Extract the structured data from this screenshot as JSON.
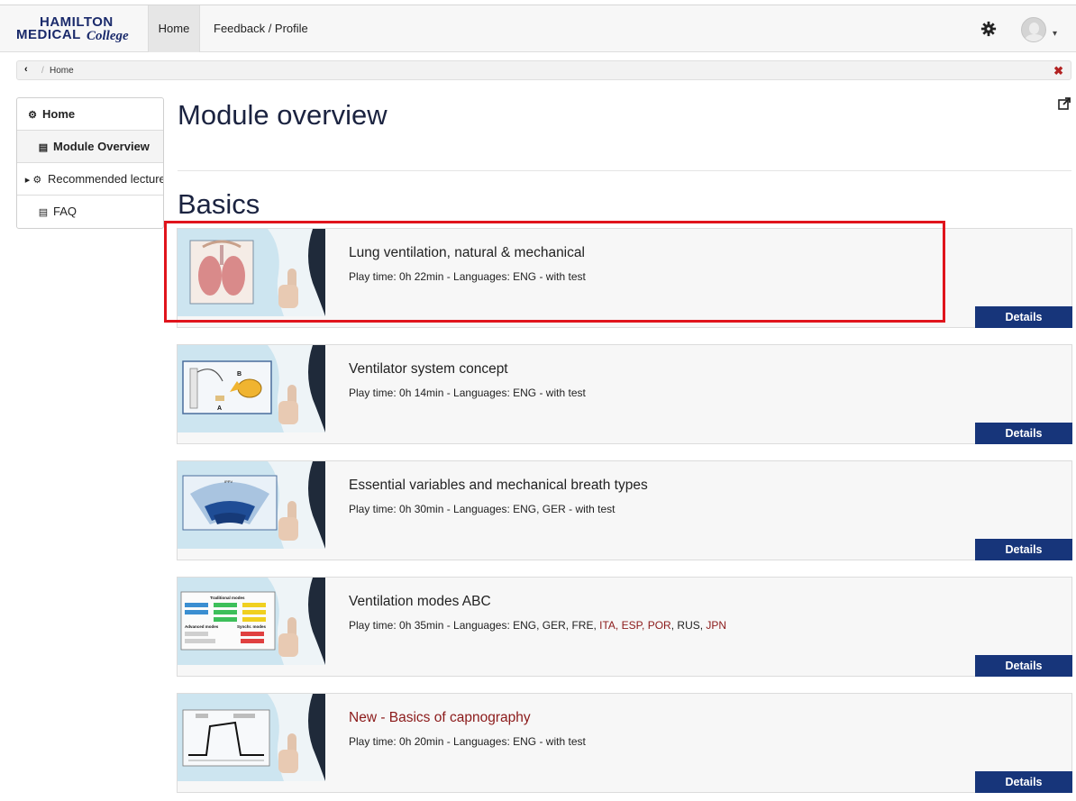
{
  "logo": {
    "line1": "HAMILTON",
    "line2": "MEDICAL",
    "line3": "College"
  },
  "nav": {
    "home": "Home",
    "feedback": "Feedback / Profile"
  },
  "breadcrumb": {
    "back": "‹",
    "separator": "/",
    "current": "Home",
    "close": "✖"
  },
  "sidebar": {
    "items": [
      {
        "icon": "⚙",
        "label": "Home"
      },
      {
        "icon": "▤",
        "label": "Module Overview"
      },
      {
        "icon": "▸ ⚙",
        "label": "Recommended lectures"
      },
      {
        "icon": "▤",
        "label": "FAQ"
      }
    ]
  },
  "main": {
    "title": "Module overview",
    "section": "Basics",
    "details_label": "Details",
    "modules": [
      {
        "title": "Lung ventilation, natural & mechanical",
        "playtime": "0h 22min",
        "languages": "ENG",
        "test": " - with test",
        "highlighted": true
      },
      {
        "title": "Ventilator system concept",
        "playtime": "0h 14min",
        "languages": "ENG",
        "test": " - with test"
      },
      {
        "title": "Essential variables and mechanical breath types",
        "playtime": "0h 30min",
        "languages": "ENG, GER",
        "test": " - with test"
      },
      {
        "title": "Ventilation modes ABC",
        "playtime": "0h 35min",
        "languages_plain": "ENG, GER, FRE, ",
        "languages_red": "ITA, ESP, POR",
        "languages_plain2": ", RUS, ",
        "languages_red2": "JPN"
      },
      {
        "title": "New - Basics of capnography",
        "playtime": "0h 20min",
        "languages": "ENG",
        "test": " - with test",
        "is_new": true
      }
    ],
    "meta_prefix": "Play time: ",
    "meta_languages": " - Languages: "
  },
  "thumb_labels": {
    "m2_a": "A",
    "m2_b": "B",
    "m3_top": "IPPV",
    "m4_title": "Traditional modes",
    "m4_adv": "Advanced modes",
    "m4_syn": "Synchr. modes"
  },
  "colors": {
    "accent": "#17357a",
    "highlight": "#e0141c",
    "new_title": "#8b1a1a"
  }
}
